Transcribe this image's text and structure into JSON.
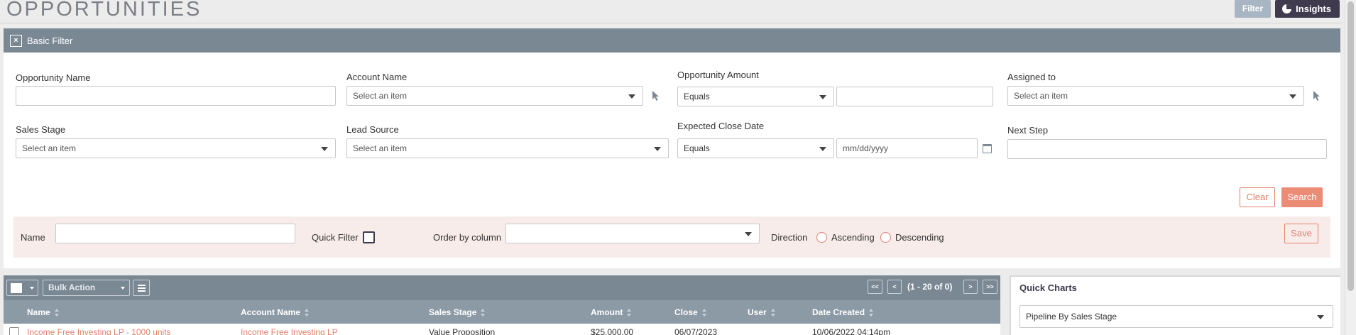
{
  "header": {
    "title": "OPPORTUNITIES",
    "filter_btn": "Filter",
    "insights_btn": "Insights"
  },
  "filter": {
    "title": "Basic Filter",
    "fields": {
      "opportunity_name": {
        "label": "Opportunity Name",
        "value": ""
      },
      "account_name": {
        "label": "Account Name",
        "placeholder": "Select an item"
      },
      "opportunity_amount": {
        "label": "Opportunity Amount",
        "operator": "Equals",
        "value": ""
      },
      "assigned_to": {
        "label": "Assigned to",
        "placeholder": "Select an item"
      },
      "sales_stage": {
        "label": "Sales Stage",
        "placeholder": "Select an item"
      },
      "lead_source": {
        "label": "Lead Source",
        "placeholder": "Select an item"
      },
      "expected_close_date": {
        "label": "Expected Close Date",
        "operator": "Equals",
        "placeholder": "mm/dd/yyyy"
      },
      "next_step": {
        "label": "Next Step",
        "value": ""
      }
    },
    "clear_btn": "Clear",
    "search_btn": "Search"
  },
  "saved_filter": {
    "name_label": "Name",
    "quick_filter_label": "Quick Filter",
    "order_by_label": "Order by column",
    "direction_label": "Direction",
    "ascending_label": "Ascending",
    "descending_label": "Descending",
    "save_btn": "Save"
  },
  "list": {
    "bulk_action": "Bulk Action",
    "pagination": {
      "first": "<<",
      "prev": "<",
      "count": "(1 - 20 of 0)",
      "next": ">",
      "last": ">>"
    },
    "columns": [
      "Name",
      "Account Name",
      "Sales Stage",
      "Amount",
      "Close",
      "User",
      "Date Created"
    ],
    "rows": [
      {
        "name": "Income Free Investing LP - 1000 units",
        "account": "Income Free Investing LP",
        "stage": "Value Proposition",
        "amount": "$25,000.00",
        "close": "06/07/2023",
        "user": "",
        "created": "10/06/2022 04:14pm"
      }
    ]
  },
  "quick_charts": {
    "title": "Quick Charts",
    "selected": "Pipeline By Sales Stage"
  }
}
